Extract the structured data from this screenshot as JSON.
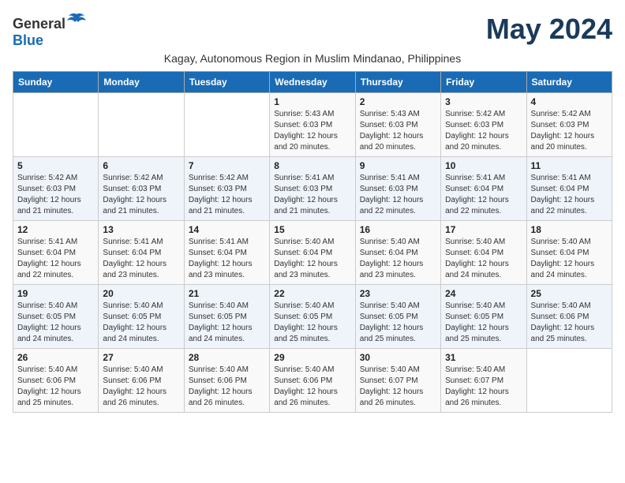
{
  "logo": {
    "general": "General",
    "blue": "Blue"
  },
  "title": "May 2024",
  "subtitle": "Kagay, Autonomous Region in Muslim Mindanao, Philippines",
  "days_of_week": [
    "Sunday",
    "Monday",
    "Tuesday",
    "Wednesday",
    "Thursday",
    "Friday",
    "Saturday"
  ],
  "weeks": [
    [
      {
        "day": "",
        "info": ""
      },
      {
        "day": "",
        "info": ""
      },
      {
        "day": "",
        "info": ""
      },
      {
        "day": "1",
        "info": "Sunrise: 5:43 AM\nSunset: 6:03 PM\nDaylight: 12 hours and 20 minutes."
      },
      {
        "day": "2",
        "info": "Sunrise: 5:43 AM\nSunset: 6:03 PM\nDaylight: 12 hours and 20 minutes."
      },
      {
        "day": "3",
        "info": "Sunrise: 5:42 AM\nSunset: 6:03 PM\nDaylight: 12 hours and 20 minutes."
      },
      {
        "day": "4",
        "info": "Sunrise: 5:42 AM\nSunset: 6:03 PM\nDaylight: 12 hours and 20 minutes."
      }
    ],
    [
      {
        "day": "5",
        "info": "Sunrise: 5:42 AM\nSunset: 6:03 PM\nDaylight: 12 hours and 21 minutes."
      },
      {
        "day": "6",
        "info": "Sunrise: 5:42 AM\nSunset: 6:03 PM\nDaylight: 12 hours and 21 minutes."
      },
      {
        "day": "7",
        "info": "Sunrise: 5:42 AM\nSunset: 6:03 PM\nDaylight: 12 hours and 21 minutes."
      },
      {
        "day": "8",
        "info": "Sunrise: 5:41 AM\nSunset: 6:03 PM\nDaylight: 12 hours and 21 minutes."
      },
      {
        "day": "9",
        "info": "Sunrise: 5:41 AM\nSunset: 6:03 PM\nDaylight: 12 hours and 22 minutes."
      },
      {
        "day": "10",
        "info": "Sunrise: 5:41 AM\nSunset: 6:04 PM\nDaylight: 12 hours and 22 minutes."
      },
      {
        "day": "11",
        "info": "Sunrise: 5:41 AM\nSunset: 6:04 PM\nDaylight: 12 hours and 22 minutes."
      }
    ],
    [
      {
        "day": "12",
        "info": "Sunrise: 5:41 AM\nSunset: 6:04 PM\nDaylight: 12 hours and 22 minutes."
      },
      {
        "day": "13",
        "info": "Sunrise: 5:41 AM\nSunset: 6:04 PM\nDaylight: 12 hours and 23 minutes."
      },
      {
        "day": "14",
        "info": "Sunrise: 5:41 AM\nSunset: 6:04 PM\nDaylight: 12 hours and 23 minutes."
      },
      {
        "day": "15",
        "info": "Sunrise: 5:40 AM\nSunset: 6:04 PM\nDaylight: 12 hours and 23 minutes."
      },
      {
        "day": "16",
        "info": "Sunrise: 5:40 AM\nSunset: 6:04 PM\nDaylight: 12 hours and 23 minutes."
      },
      {
        "day": "17",
        "info": "Sunrise: 5:40 AM\nSunset: 6:04 PM\nDaylight: 12 hours and 24 minutes."
      },
      {
        "day": "18",
        "info": "Sunrise: 5:40 AM\nSunset: 6:04 PM\nDaylight: 12 hours and 24 minutes."
      }
    ],
    [
      {
        "day": "19",
        "info": "Sunrise: 5:40 AM\nSunset: 6:05 PM\nDaylight: 12 hours and 24 minutes."
      },
      {
        "day": "20",
        "info": "Sunrise: 5:40 AM\nSunset: 6:05 PM\nDaylight: 12 hours and 24 minutes."
      },
      {
        "day": "21",
        "info": "Sunrise: 5:40 AM\nSunset: 6:05 PM\nDaylight: 12 hours and 24 minutes."
      },
      {
        "day": "22",
        "info": "Sunrise: 5:40 AM\nSunset: 6:05 PM\nDaylight: 12 hours and 25 minutes."
      },
      {
        "day": "23",
        "info": "Sunrise: 5:40 AM\nSunset: 6:05 PM\nDaylight: 12 hours and 25 minutes."
      },
      {
        "day": "24",
        "info": "Sunrise: 5:40 AM\nSunset: 6:05 PM\nDaylight: 12 hours and 25 minutes."
      },
      {
        "day": "25",
        "info": "Sunrise: 5:40 AM\nSunset: 6:06 PM\nDaylight: 12 hours and 25 minutes."
      }
    ],
    [
      {
        "day": "26",
        "info": "Sunrise: 5:40 AM\nSunset: 6:06 PM\nDaylight: 12 hours and 25 minutes."
      },
      {
        "day": "27",
        "info": "Sunrise: 5:40 AM\nSunset: 6:06 PM\nDaylight: 12 hours and 26 minutes."
      },
      {
        "day": "28",
        "info": "Sunrise: 5:40 AM\nSunset: 6:06 PM\nDaylight: 12 hours and 26 minutes."
      },
      {
        "day": "29",
        "info": "Sunrise: 5:40 AM\nSunset: 6:06 PM\nDaylight: 12 hours and 26 minutes."
      },
      {
        "day": "30",
        "info": "Sunrise: 5:40 AM\nSunset: 6:07 PM\nDaylight: 12 hours and 26 minutes."
      },
      {
        "day": "31",
        "info": "Sunrise: 5:40 AM\nSunset: 6:07 PM\nDaylight: 12 hours and 26 minutes."
      },
      {
        "day": "",
        "info": ""
      }
    ]
  ]
}
